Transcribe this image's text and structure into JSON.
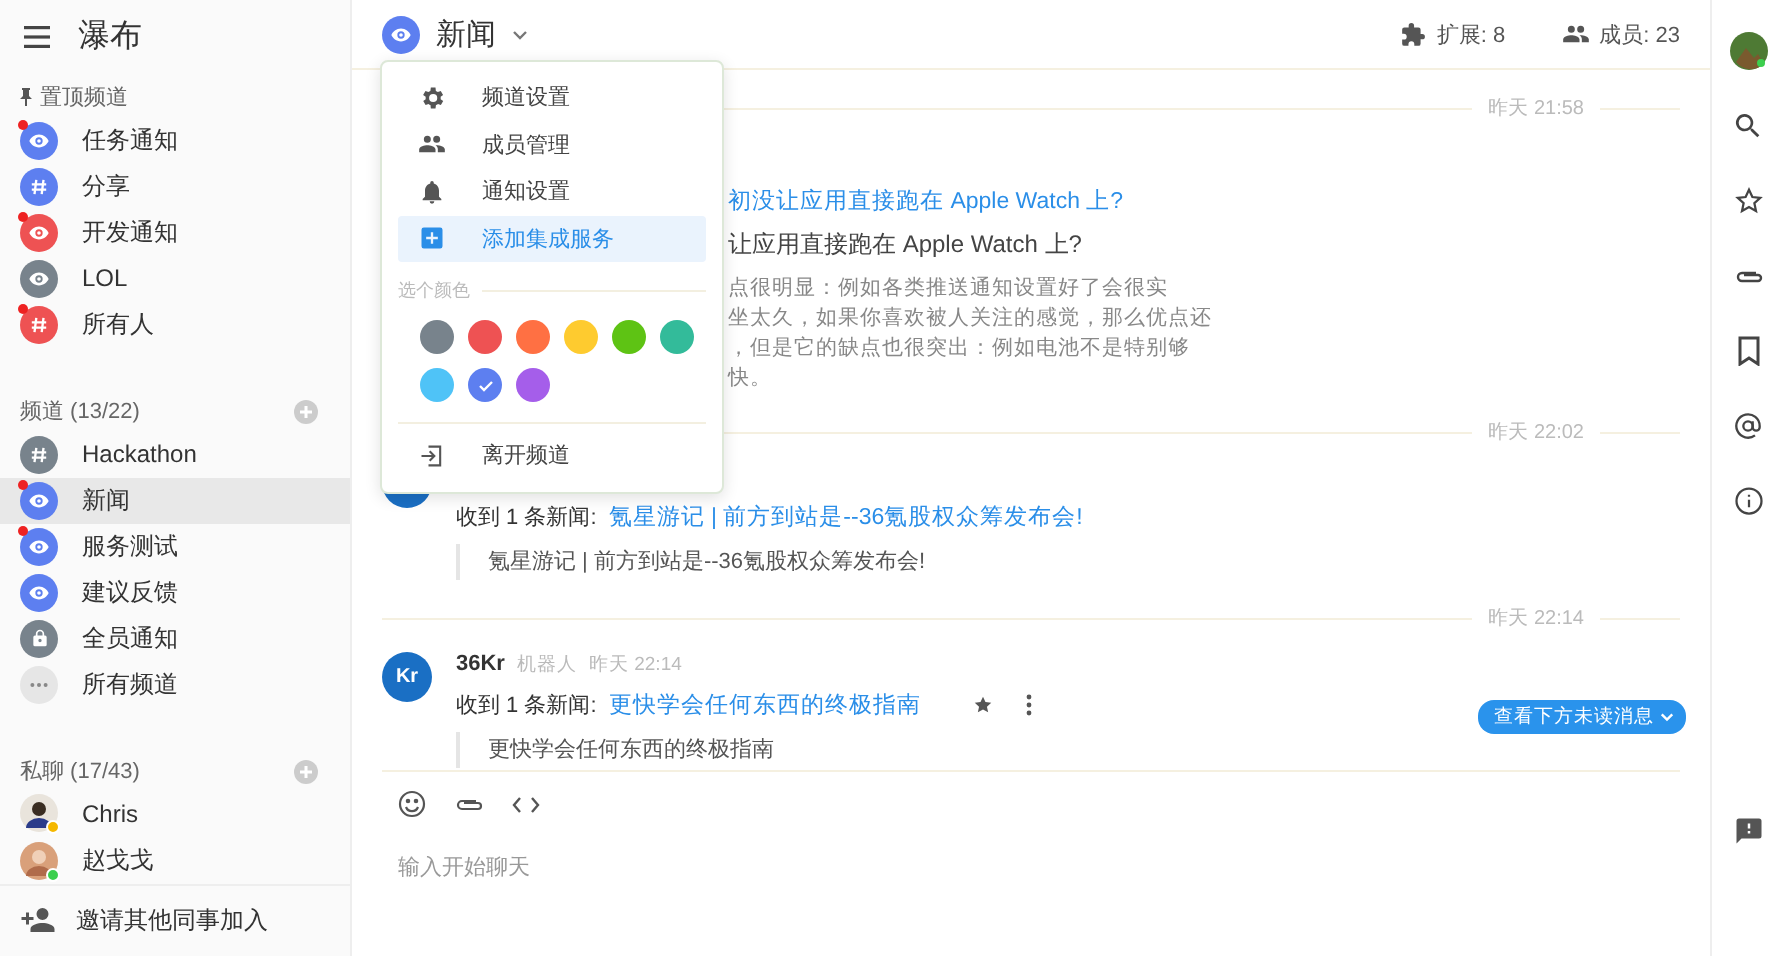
{
  "sidebar": {
    "title": "瀑布",
    "pinned": {
      "heading": "置顶频道",
      "items": [
        {
          "name": "任务通知",
          "kind": "eye",
          "color": "#5d7ff0",
          "unread": true,
          "selected": false
        },
        {
          "name": "分享",
          "kind": "hash",
          "color": "#5d7ff0",
          "unread": false,
          "selected": false
        },
        {
          "name": "开发通知",
          "kind": "eye",
          "color": "#ee5253",
          "unread": true,
          "selected": false
        },
        {
          "name": "LOL",
          "kind": "eye",
          "color": "#78838c",
          "unread": false,
          "selected": false
        },
        {
          "name": "所有人",
          "kind": "hash",
          "color": "#ee5253",
          "unread": true,
          "selected": false
        }
      ]
    },
    "channels": {
      "heading": "频道 (13/22)",
      "items": [
        {
          "name": "Hackathon",
          "kind": "hash",
          "color": "#78838c",
          "unread": false,
          "selected": false
        },
        {
          "name": "新闻",
          "kind": "eye",
          "color": "#5d7ff0",
          "unread": true,
          "selected": true
        },
        {
          "name": "服务测试",
          "kind": "eye",
          "color": "#5d7ff0",
          "unread": true,
          "selected": false
        },
        {
          "name": "建议反馈",
          "kind": "eye",
          "color": "#5d7ff0",
          "unread": false,
          "selected": false
        },
        {
          "name": "全员通知",
          "kind": "lock",
          "color": "#78838c",
          "unread": false,
          "selected": false
        },
        {
          "name": "所有频道",
          "kind": "more",
          "color": "#e6e6e6",
          "unread": false,
          "selected": false
        }
      ]
    },
    "direct": {
      "heading": "私聊 (17/43)",
      "items": [
        {
          "name": "Chris",
          "color": "#f5b800"
        },
        {
          "name": "赵戈戈",
          "color": "#3ccf4e"
        }
      ]
    },
    "invite": "邀请其他同事加入"
  },
  "header": {
    "channel": "新闻",
    "extensions": "扩展: 8",
    "members": "成员: 23"
  },
  "menu": {
    "items": [
      {
        "label": "频道设置",
        "kind": "gear",
        "selected": false
      },
      {
        "label": "成员管理",
        "kind": "people",
        "selected": false
      },
      {
        "label": "通知设置",
        "kind": "bell",
        "selected": false
      },
      {
        "label": "添加集成服务",
        "kind": "plus",
        "selected": true
      }
    ],
    "color_heading": "选个颜色",
    "colors": [
      {
        "color": "#78838c",
        "selected": false
      },
      {
        "color": "#ee5253",
        "selected": false
      },
      {
        "color": "#ff7043",
        "selected": false
      },
      {
        "color": "#fecb2f",
        "selected": false
      },
      {
        "color": "#5ec314",
        "selected": false
      },
      {
        "color": "#33bb9a",
        "selected": false
      },
      {
        "color": "#4fc3f7",
        "selected": false
      },
      {
        "color": "#5d7ff0",
        "selected": true
      },
      {
        "color": "#a55eea",
        "selected": false
      }
    ],
    "leave": "离开频道"
  },
  "messages": [
    {
      "kind": "covered",
      "time": "昨天 21:58",
      "link": "初没让应用直接跑在 Apple Watch 上?",
      "title": "让应用直接跑在 Apple Watch 上?",
      "lines": [
        "点很明显：例如各类推送通知设置好了会很实",
        "坐太久，如果你喜欢被人关注的感觉，那么优点还",
        "，但是它的缺点也很突出：例如电池不是特别够",
        "快。"
      ]
    },
    {
      "kind": "news",
      "time": "昨天 22:02",
      "prefix": "收到 1 条新闻:",
      "link": "氪星游记 | 前方到站是--36氪股权众筹发布会!",
      "quote": "氪星游记 | 前方到站是--36氪股权众筹发布会!"
    },
    {
      "kind": "news",
      "time": "昨天 22:14",
      "sender": "36Kr",
      "avatar": "Kr",
      "role": "机器人",
      "sent": "昨天 22:14",
      "prefix": "收到 1 条新闻:",
      "link": "更快学会任何东西的终极指南",
      "quote": "更快学会任何东西的终极指南",
      "actions": true
    }
  ],
  "unread_button": "查看下方未读消息",
  "composer": {
    "placeholder": "输入开始聊天"
  }
}
